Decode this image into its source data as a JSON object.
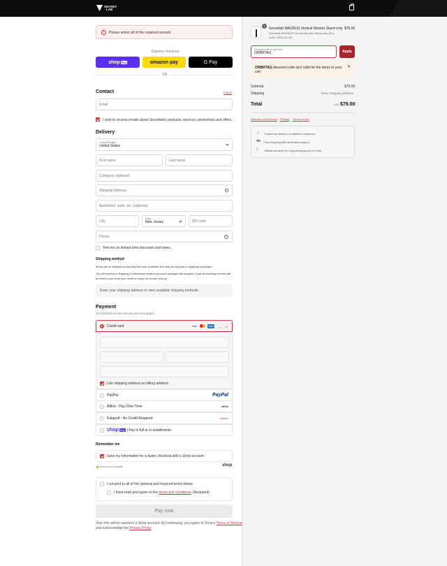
{
  "brand": {
    "name_line1": "SECRET",
    "name_line2": "LAB"
  },
  "alert": {
    "message": "Please select all of the required consent"
  },
  "express": {
    "title": "Express checkout",
    "shop_label": "shop",
    "shop_pay": "Pay",
    "amazon_label": "amazon pay",
    "gpay_label": "G Pay",
    "or_label": "OR"
  },
  "contact": {
    "title": "Contact",
    "login_link": "Log in",
    "email_placeholder": "Email",
    "marketing_label": "I wish to receive emails about Secretlab's products, services, promotions and offers"
  },
  "delivery": {
    "title": "Delivery",
    "country_label": "Country/Region",
    "country_value": "United States",
    "first_name": "First name",
    "last_name": "Last name",
    "company": "Company (optional)",
    "address": "Shipping Address",
    "apartment": "Apartment, suite, etc. (optional)",
    "city": "City",
    "state_label": "State",
    "state_value": "New Jersey",
    "zip": "ZIP code",
    "phone": "Phone",
    "sms_label": "Text me on limited-time discounts and news"
  },
  "shipping": {
    "title": "Shipping method",
    "note1": "Items will be shipped out as they become available and may be shipped in separate packages.",
    "note2a": "You will receive a Shipping Confirmation email once each package has shipped. A parcel tracking number will",
    "note2b": "be sent to you once your order is ready for courier pick-up.",
    "placeholder": "Enter your shipping address to view available shipping methods."
  },
  "payment": {
    "title": "Payment",
    "subtitle": "All transactions are secure and encrypted.",
    "credit_card": "Credit card",
    "more_cards": "+5",
    "billing_label": "Use shipping address as billing address",
    "paypal": "PayPal",
    "paypal_logo": "PayPal",
    "affirm": "Affirm - Pay Over Time",
    "affirm_logo": "affirm",
    "katapult": "Katapult - No Credit Required",
    "katapult_logo": "katapult",
    "shoppay_label": "| Pay in full or in installments",
    "shoppay_shop": "shop",
    "shoppay_pay": "Pay"
  },
  "remember": {
    "title": "Remember me",
    "save_label": "Save my information for a faster checkout with a Shop account",
    "secure_label": "Secure and encrypted",
    "shop_logo": "shop"
  },
  "consent": {
    "all_label": "I consent to all of the optional and required terms below",
    "terms_prefix": "I have read and agree to the ",
    "terms_link": "terms and conditions",
    "terms_suffix": ". (Required)"
  },
  "pay_button": "Pay now",
  "footer": {
    "text1": "Your info will be saved to a Shop account. By continuing, you agree to Shop's ",
    "tos_link": "Terms of Service",
    "text2": "and acknowledge the ",
    "privacy_link": "Privacy Policy",
    "end": "."
  },
  "summary": {
    "qty": "1",
    "product_name": "Secretlab MAGNUS Vertical Monitor Stand only",
    "product_variant1": "Secretlab MAGNUS Vertical Monitor Stand only (Pre-",
    "product_variant2": "order: 2025-02-24)",
    "product_price": "$79.00",
    "discount_label": "Discount code or gift card",
    "discount_value": "ORBRTAG",
    "apply_label": "Apply",
    "warn_code": "ORBRTAG",
    "warn_text1": " discount code isn't valid for the items in your",
    "warn_text2": "cart",
    "subtotal_label": "Subtotal",
    "subtotal_value": "$79.00",
    "shipping_label": "Shipping",
    "shipping_value": "Enter shipping address",
    "total_label": "Total",
    "currency": "USD",
    "total_value": "$79.00",
    "links": [
      "Warranty and Refund",
      "Privacy",
      "Terms of Use"
    ],
    "trust": [
      "Trusted by millions of satisfied customers",
      "Fast shipping with dedicated support",
      "Official warranty for long-lasting peace of mind"
    ]
  },
  "colors": {
    "accent": "#c9393c",
    "shop_purple": "#5a31f4",
    "amazon_yellow": "#ffd814"
  }
}
